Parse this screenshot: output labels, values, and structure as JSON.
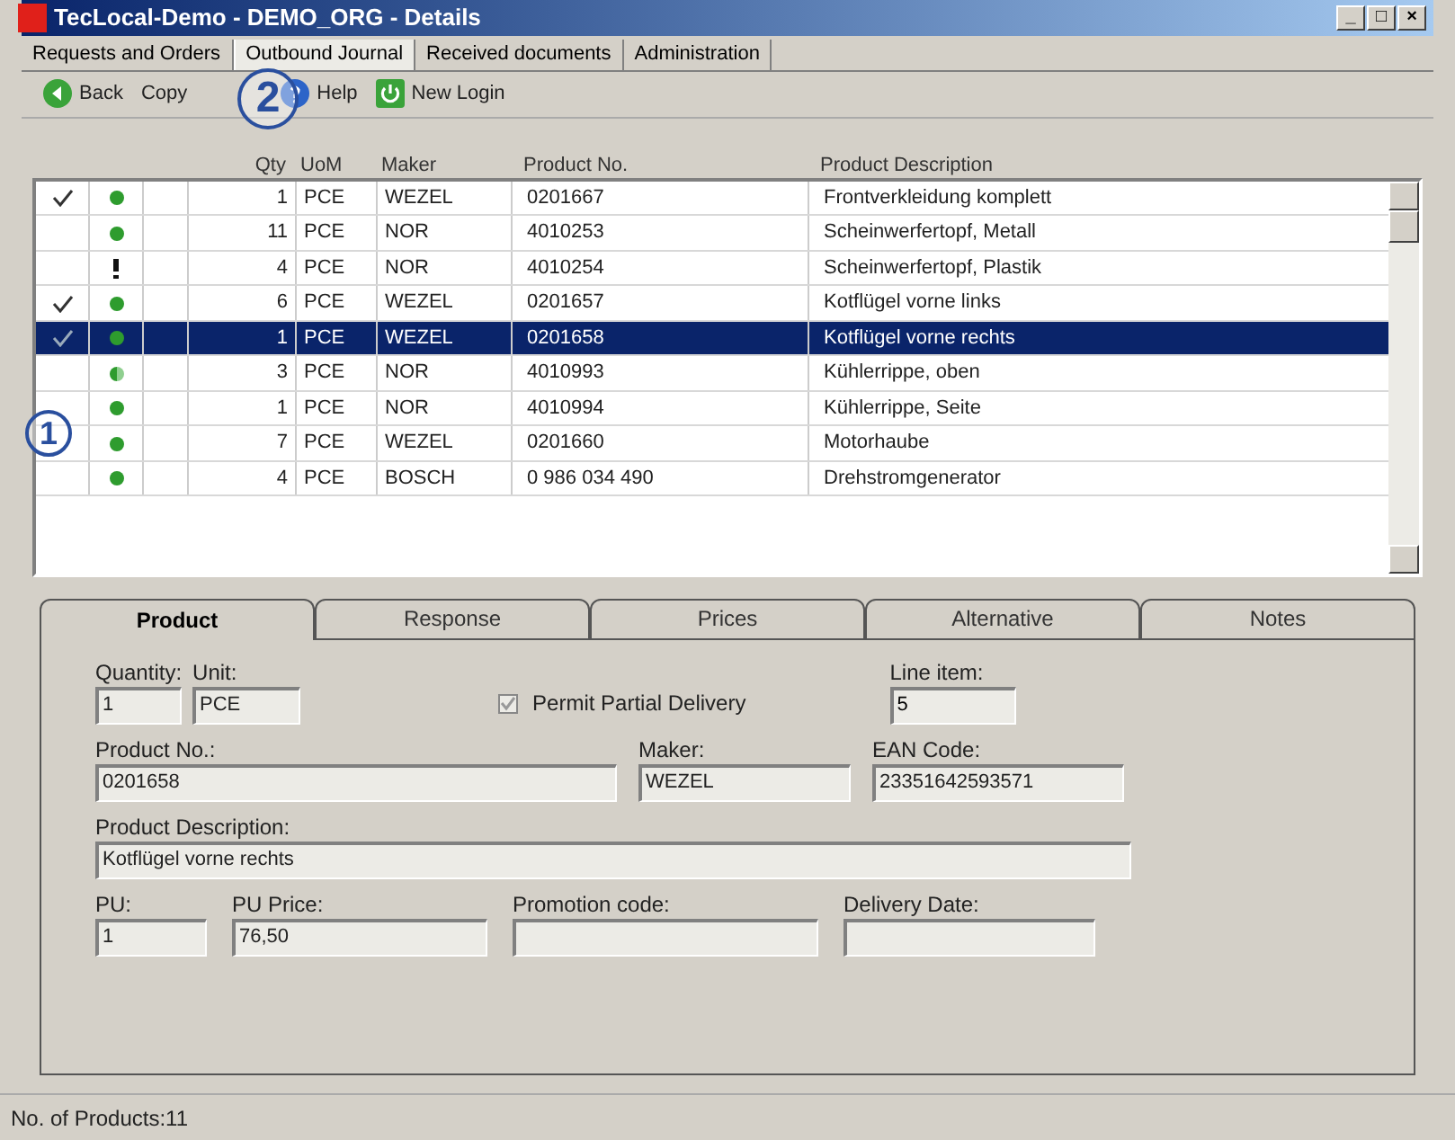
{
  "window": {
    "title": "TecLocal-Demo - DEMO_ORG - Details",
    "controls": [
      "_",
      "□",
      "×"
    ]
  },
  "tabs": [
    {
      "label": "Requests and Orders",
      "selected": false
    },
    {
      "label": "Outbound Journal",
      "selected": true
    },
    {
      "label": "Received documents",
      "selected": false
    },
    {
      "label": "Administration",
      "selected": false
    }
  ],
  "toolbar": [
    {
      "kind": "back",
      "label": "Back"
    },
    {
      "kind": "text",
      "label": "Copy"
    },
    {
      "kind": "hidden"
    },
    {
      "kind": "help",
      "label": "Help"
    },
    {
      "kind": "login",
      "label": "New Login"
    }
  ],
  "table": {
    "columns": [
      "Qty",
      "UoM",
      "Maker",
      "Product No.",
      "Product Description"
    ],
    "rows": [
      {
        "checked": true,
        "kind": "ok",
        "selected": false,
        "cells": [
          "1",
          "PCE",
          "WEZEL",
          "0201667",
          "Frontverkleidung komplett"
        ]
      },
      {
        "checked": false,
        "kind": "ok",
        "selected": false,
        "cells": [
          "11",
          "PCE",
          "NOR",
          "4010253",
          "Scheinwerfertopf, Metall"
        ]
      },
      {
        "checked": false,
        "kind": "warning",
        "selected": false,
        "cells": [
          "4",
          "PCE",
          "NOR",
          "4010254",
          "Scheinwerfertopf, Plastik"
        ]
      },
      {
        "checked": true,
        "kind": "ok",
        "selected": false,
        "cells": [
          "6",
          "PCE",
          "WEZEL",
          "0201657",
          "Kotflügel vorne links"
        ]
      },
      {
        "checked": true,
        "kind": "ok",
        "selected": true,
        "cells": [
          "1",
          "PCE",
          "WEZEL",
          "0201658",
          "Kotflügel vorne rechts"
        ]
      },
      {
        "checked": false,
        "kind": "partial",
        "selected": false,
        "cells": [
          "3",
          "PCE",
          "NOR",
          "4010993",
          "Kühlerrippe, oben"
        ]
      },
      {
        "checked": false,
        "kind": "ok",
        "selected": false,
        "cells": [
          "1",
          "PCE",
          "NOR",
          "4010994",
          "Kühlerrippe, Seite"
        ]
      },
      {
        "checked": false,
        "kind": "ok",
        "selected": false,
        "cells": [
          "7",
          "PCE",
          "WEZEL",
          "0201660",
          "Motorhaube"
        ]
      },
      {
        "checked": false,
        "kind": "ok",
        "selected": false,
        "cells": [
          "4",
          "PCE",
          "BOSCH",
          "0 986 034 490",
          "Drehstromgenerator"
        ]
      }
    ]
  },
  "annotations": [
    "1",
    "2"
  ],
  "detail_tabs": [
    {
      "label": "Product",
      "selected": true
    },
    {
      "label": "Response",
      "selected": false
    },
    {
      "label": "Prices",
      "selected": false
    },
    {
      "label": "Alternative",
      "selected": false
    },
    {
      "label": "Notes",
      "selected": false
    }
  ],
  "product": {
    "quantity": {
      "label": "Quantity:",
      "value": "1"
    },
    "unit": {
      "label": "Unit:",
      "value": "PCE"
    },
    "partial_delivery": {
      "label": "Permit Partial Delivery",
      "checked": true
    },
    "line_item": {
      "label": "Line item:",
      "value": "5"
    },
    "product_no": {
      "label": "Product No.:",
      "value": "0201658"
    },
    "maker": {
      "label": "Maker:",
      "value": "WEZEL"
    },
    "ean": {
      "label": "EAN Code:",
      "value": "23351642593571"
    },
    "description": {
      "label": "Product Description:",
      "value": "Kotflügel vorne rechts"
    },
    "pu": {
      "label": "PU:",
      "value": "1"
    },
    "pu_price": {
      "label": "PU Price:",
      "value": "76,50"
    },
    "promotion_code": {
      "label": "Promotion code:"
    },
    "delivery_date": {
      "label": "Delivery Date:"
    }
  },
  "status_bar": "No. of Products:11"
}
